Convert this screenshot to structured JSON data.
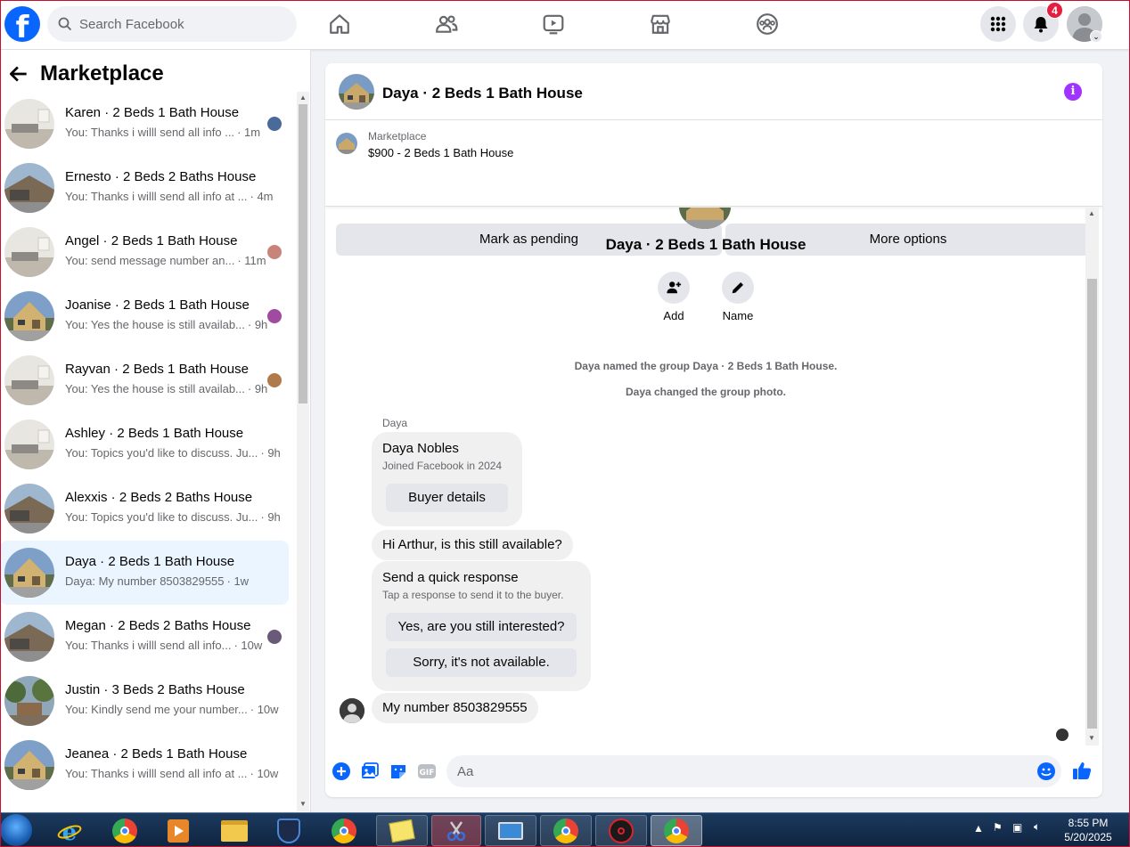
{
  "topbar": {
    "search_placeholder": "Search Facebook",
    "notification_count": "4",
    "nav_icons": [
      "home-icon",
      "friends-icon",
      "watch-icon",
      "marketplace-icon",
      "groups-icon"
    ],
    "brand_color": "#0866ff"
  },
  "sidebar": {
    "title": "Marketplace",
    "conversations": [
      {
        "title": "Karen · 2 Beds 1 Bath House",
        "snippet": "You: Thanks i willl send all info ...",
        "time": "· 1m",
        "thumb": "interior"
      },
      {
        "title": "Ernesto · 2 Beds 2 Baths House",
        "snippet": "You: Thanks i willl send all info at ...",
        "time": "· 4m",
        "thumb": "exterior"
      },
      {
        "title": "Angel · 2 Beds 1 Bath House",
        "snippet": "You: send message number an...",
        "time": "· 11m",
        "thumb": "interior"
      },
      {
        "title": "Joanise · 2 Beds 1 Bath House",
        "snippet": "You: Yes the house is still availab...",
        "time": "· 9h",
        "thumb": "house"
      },
      {
        "title": "Rayvan · 2 Beds 1 Bath House",
        "snippet": "You: Yes the house is still availab...",
        "time": "· 9h",
        "thumb": "interior"
      },
      {
        "title": "Ashley · 2 Beds 1 Bath House",
        "snippet": "You: Topics you'd like to discuss. Ju...",
        "time": "· 9h",
        "thumb": "interior"
      },
      {
        "title": "Alexxis · 2 Beds 2 Baths House",
        "snippet": "You: Topics you'd like to discuss. Ju...",
        "time": "· 9h",
        "thumb": "exterior"
      },
      {
        "title": "Daya · 2 Beds 1 Bath House",
        "snippet": "Daya: My number 8503829555",
        "time": "· 1w",
        "thumb": "house"
      },
      {
        "title": "Megan · 2 Beds 2 Baths House",
        "snippet": "You: Thanks i willl send all info...",
        "time": "· 10w",
        "thumb": "exterior"
      },
      {
        "title": "Justin · 3 Beds 2 Baths House",
        "snippet": "You: Kindly send me your number...",
        "time": "· 10w",
        "thumb": "trees"
      },
      {
        "title": "Jeanea · 2 Beds 1 Bath House",
        "snippet": "You: Thanks i willl send all info at ...",
        "time": "· 10w",
        "thumb": "house"
      }
    ]
  },
  "chat": {
    "title": "Daya · 2 Beds 1 Bath House",
    "marketplace_label": "Marketplace",
    "listing": "$900 - 2 Beds 1 Bath House",
    "mark_pending": "Mark as pending",
    "more_options": "More options",
    "group_name": "Daya · 2 Beds 1 Bath House",
    "add_label": "Add",
    "name_label": "Name",
    "sys_1": "Daya named the group Daya · 2 Beds 1 Bath House.",
    "sys_2": "Daya changed the group photo.",
    "sender": "Daya",
    "profile_name": "Daya Nobles",
    "profile_joined": "Joined Facebook in 2024",
    "buyer_details": "Buyer details",
    "msg_1": "Hi Arthur, is this still available?",
    "quick_title": "Send a quick response",
    "quick_sub": "Tap a response to send it to the buyer.",
    "quick_1": "Yes, are you still interested?",
    "quick_2": "Sorry, it's not available.",
    "msg_2": "My number 8503829555",
    "composer_placeholder": "Aa",
    "accent": "#0866ff",
    "info_color": "#a033ff"
  },
  "taskbar": {
    "time": "8:55 PM",
    "date": "5/20/2025"
  }
}
